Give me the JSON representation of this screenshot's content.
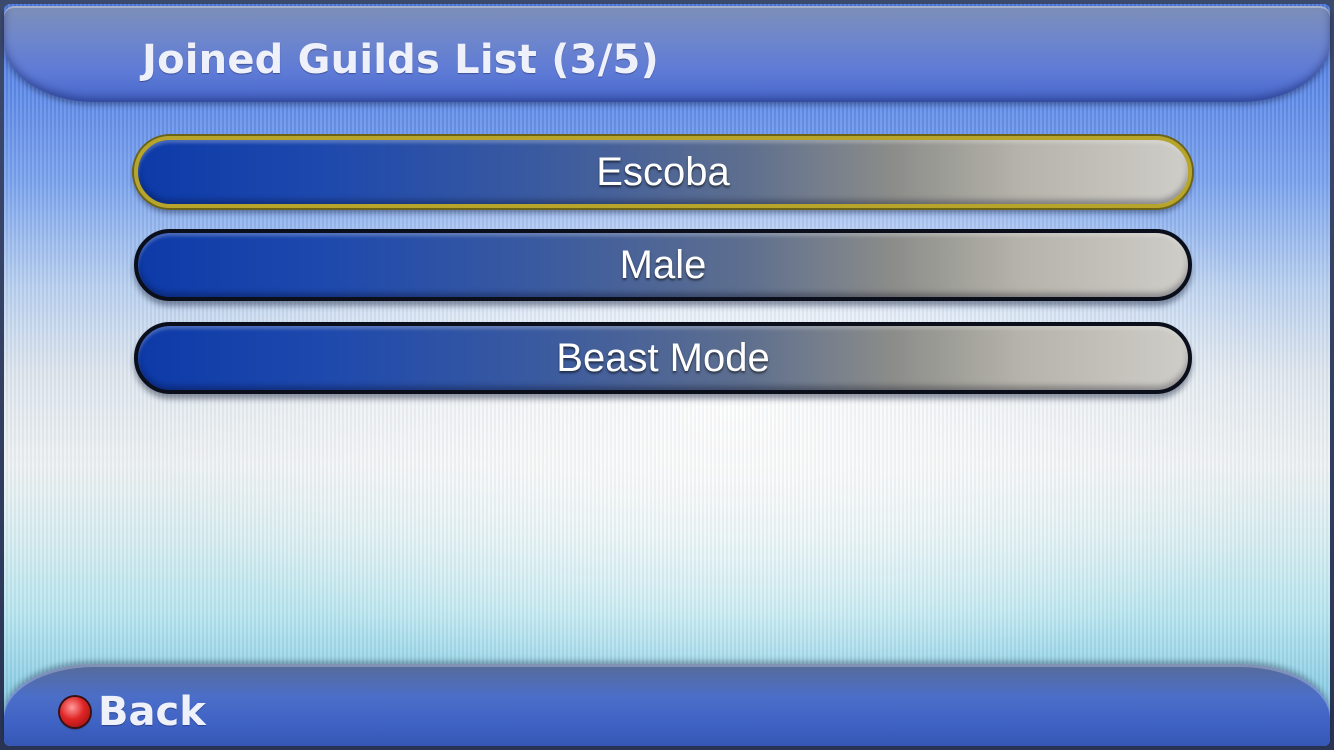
{
  "header": {
    "title": "Joined Guilds List (3/5)"
  },
  "guilds": [
    {
      "name": "Escoba"
    },
    {
      "name": "Male"
    },
    {
      "name": "Beast Mode"
    }
  ],
  "selected_index": 0,
  "footer": {
    "back_icon": "red-dot-icon",
    "back_label": "Back"
  },
  "colors": {
    "accent_blue": "#1e49ad",
    "selection_border": "#b7a42a",
    "back_button_dot": "#e02525"
  }
}
